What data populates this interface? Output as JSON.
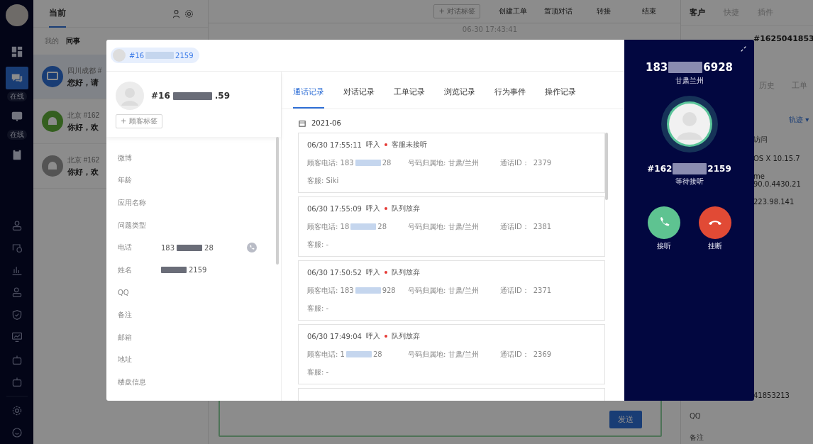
{
  "nav": {
    "items": [
      {
        "kind": "grid",
        "selected": false
      },
      {
        "kind": "chat",
        "selected": true,
        "badge": "在线"
      },
      {
        "kind": "phone",
        "selected": false,
        "badge": "在线"
      },
      {
        "kind": "clipboard",
        "selected": false
      }
    ],
    "tools": [
      {
        "kind": "user"
      },
      {
        "kind": "history"
      },
      {
        "kind": "chart"
      },
      {
        "kind": "users"
      },
      {
        "kind": "shield"
      },
      {
        "kind": "monitor"
      },
      {
        "kind": "robot"
      },
      {
        "kind": "robot"
      }
    ],
    "bottom": [
      {
        "kind": "gear"
      },
      {
        "kind": "bubble"
      }
    ]
  },
  "conversations": {
    "title": "当前",
    "filters": [
      {
        "label": "我的",
        "selected": false
      },
      {
        "label": "同事",
        "selected": true
      }
    ],
    "items": [
      {
        "kind": "desktop",
        "selected": true,
        "source": "四川成都 #",
        "message": "您好，请"
      },
      {
        "kind": "android",
        "selected": false,
        "source": "北京 #162",
        "message": "你好，欢"
      },
      {
        "kind": "android-offline",
        "selected": false,
        "source": "北京 #162",
        "message": "你好，欢"
      }
    ]
  },
  "chat": {
    "tag_button": "+ 对话标签",
    "actions": [
      "创建工单",
      "置顶对话",
      "转接",
      "结束"
    ],
    "timestamp": "06-30 17:43:41",
    "send_button": "发送"
  },
  "customer_panel": {
    "tabs": [
      {
        "label": "客户",
        "selected": true
      },
      {
        "label": "快捷",
        "selected": false
      },
      {
        "label": "插件",
        "selected": false
      }
    ],
    "id": "#1625041853",
    "subtabs": [
      "历史",
      "工单"
    ],
    "track": "轨迹 ▾",
    "rows": [
      "访问",
      "OS X 10.15.7",
      "me 90.0.4430.21",
      "223.98.141"
    ],
    "id2": "41853213",
    "fields": [
      "QQ",
      "备注"
    ]
  },
  "modal": {
    "chip": {
      "start": "#16",
      "end": "2159"
    },
    "customer": {
      "name": {
        "start": "#16",
        "end": ".59"
      },
      "tag_button": "+ 顾客标签"
    },
    "fields": [
      {
        "label": "微博"
      },
      {
        "label": "年龄"
      },
      {
        "label": "应用名称"
      },
      {
        "label": "问题类型"
      },
      {
        "label": "电话",
        "value": {
          "start": "183",
          "end": "28"
        },
        "kind": "phone"
      },
      {
        "label": "姓名",
        "value": {
          "end": "2159"
        }
      },
      {
        "label": "QQ"
      },
      {
        "label": "备注"
      },
      {
        "label": "邮箱"
      },
      {
        "label": "地址"
      },
      {
        "label": "楼盘信息"
      }
    ],
    "tabs": [
      {
        "label": "通话记录",
        "selected": true
      },
      {
        "label": "对话记录",
        "selected": false
      },
      {
        "label": "工单记录",
        "selected": false
      },
      {
        "label": "浏览记录",
        "selected": false
      },
      {
        "label": "行为事件",
        "selected": false
      },
      {
        "label": "操作记录",
        "selected": false
      }
    ],
    "month": "2021-06",
    "records": [
      {
        "time": "06/30 17:55:11",
        "direction": "呼入",
        "status": "客服未接听",
        "color": "#e53935",
        "phone": {
          "start": "顾客电话: 183",
          "end": "28"
        },
        "location": "号码归属地: 甘肃/兰州",
        "call_id_label": "通话ID：",
        "call_id": "2379",
        "agent": "客服: Siki"
      },
      {
        "time": "06/30 17:55:09",
        "direction": "呼入",
        "status": "队列放弃",
        "color": "#e53935",
        "phone": {
          "start": "顾客电话: 18",
          "end": "28"
        },
        "location": "号码归属地: 甘肃/兰州",
        "call_id_label": "通话ID：",
        "call_id": "2381",
        "agent": "客服: -"
      },
      {
        "time": "06/30 17:50:52",
        "direction": "呼入",
        "status": "队列放弃",
        "color": "#e53935",
        "phone": {
          "start": "顾客电话: 183",
          "end": "928"
        },
        "location": "号码归属地: 甘肃/兰州",
        "call_id_label": "通话ID：",
        "call_id": "2371",
        "agent": "客服: -"
      },
      {
        "time": "06/30 17:49:04",
        "direction": "呼入",
        "status": "队列放弃",
        "color": "#e53935",
        "phone": {
          "start": "顾客电话: 1",
          "end": "28"
        },
        "location": "号码归属地: 甘肃/兰州",
        "call_id_label": "通话ID：",
        "call_id": "2369",
        "agent": "客服: -"
      }
    ]
  },
  "call": {
    "number": {
      "start": "183",
      "end": "6928"
    },
    "location": "甘肃兰州",
    "caller": {
      "start": "#162",
      "end": "2159"
    },
    "status": "等待接听",
    "accept": "接听",
    "hangup": "挂断"
  }
}
